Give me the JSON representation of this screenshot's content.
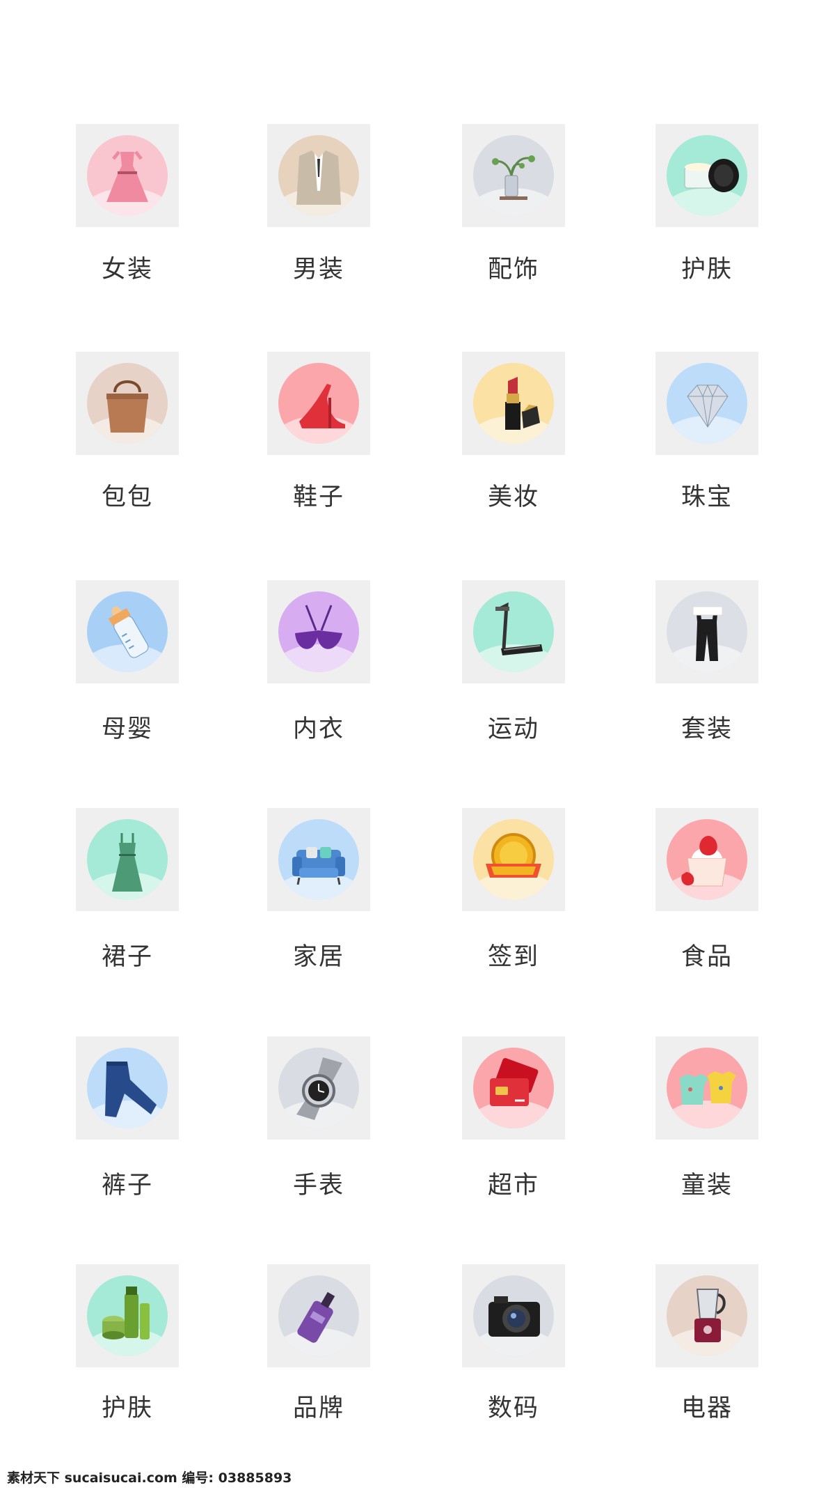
{
  "categories": [
    {
      "label": "女装",
      "icon": "dress-icon",
      "bg": "#f9c6d0"
    },
    {
      "label": "男装",
      "icon": "suit-icon",
      "bg": "#e6d2bd"
    },
    {
      "label": "配饰",
      "icon": "vase-icon",
      "bg": "#d9dde3"
    },
    {
      "label": "护肤",
      "icon": "cream-jar-icon",
      "bg": "#a4ead6"
    },
    {
      "label": "包包",
      "icon": "handbag-icon",
      "bg": "#e6d2c6"
    },
    {
      "label": "鞋子",
      "icon": "high-heel-icon",
      "bg": "#fba6aa"
    },
    {
      "label": "美妆",
      "icon": "lipstick-icon",
      "bg": "#fbe1a3"
    },
    {
      "label": "珠宝",
      "icon": "diamond-icon",
      "bg": "#bddcfa"
    },
    {
      "label": "母婴",
      "icon": "baby-bottle-icon",
      "bg": "#a8d0f7"
    },
    {
      "label": "内衣",
      "icon": "bra-icon",
      "bg": "#d8acf0"
    },
    {
      "label": "运动",
      "icon": "treadmill-icon",
      "bg": "#a4ead6"
    },
    {
      "label": "套装",
      "icon": "overalls-icon",
      "bg": "#dcdfe5"
    },
    {
      "label": "裙子",
      "icon": "green-dress-icon",
      "bg": "#a4ead6"
    },
    {
      "label": "家居",
      "icon": "sofa-icon",
      "bg": "#bddcfa"
    },
    {
      "label": "签到",
      "icon": "gold-coin-icon",
      "bg": "#fbe1a3"
    },
    {
      "label": "食品",
      "icon": "strawberry-dessert-icon",
      "bg": "#fba6aa"
    },
    {
      "label": "裤子",
      "icon": "jeans-icon",
      "bg": "#bddcfa"
    },
    {
      "label": "手表",
      "icon": "watch-icon",
      "bg": "#d9dde3"
    },
    {
      "label": "超市",
      "icon": "shopping-card-icon",
      "bg": "#fba6aa"
    },
    {
      "label": "童装",
      "icon": "kids-tshirt-icon",
      "bg": "#fba6aa"
    },
    {
      "label": "护肤",
      "icon": "skincare-bottles-icon",
      "bg": "#a4ead6"
    },
    {
      "label": "品牌",
      "icon": "perfume-bottle-icon",
      "bg": "#d9dde3"
    },
    {
      "label": "数码",
      "icon": "camera-icon",
      "bg": "#d9dde3"
    },
    {
      "label": "电器",
      "icon": "blender-icon",
      "bg": "#e6d2c6"
    }
  ],
  "watermark": "素材天下 sucaisucai.com  编号: 03885893"
}
